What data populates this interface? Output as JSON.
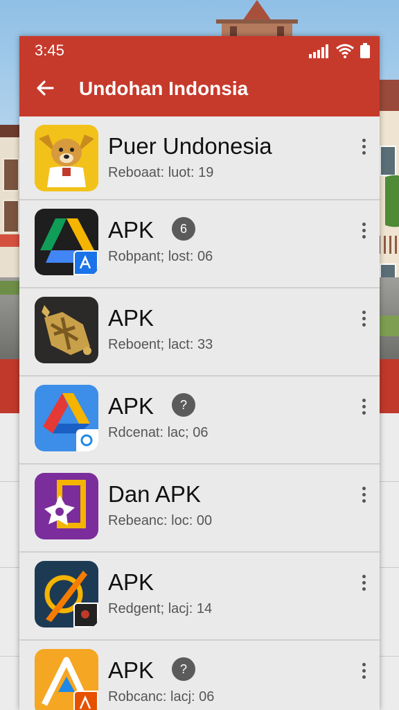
{
  "status_bar": {
    "time": "3:45"
  },
  "app_bar": {
    "title": "Undohan Indonsia"
  },
  "apps": [
    {
      "title": "Puer Undonesia",
      "subtitle": "Reboaat: luot: 19",
      "badge": ""
    },
    {
      "title": "APK",
      "subtitle": "Robpant; lost: 06",
      "badge": "6"
    },
    {
      "title": "APK",
      "subtitle": "Reboent; lact: 33",
      "badge": ""
    },
    {
      "title": "APK",
      "subtitle": "Rdcenat: lac; 06",
      "badge": "?"
    },
    {
      "title": "Dan APK",
      "subtitle": "Rebeanc: loc: 00",
      "badge": ""
    },
    {
      "title": "APK",
      "subtitle": "Redgent; lacj: 14",
      "badge": ""
    },
    {
      "title": "APK",
      "subtitle": "Robcanc: lacj: 06",
      "badge": "?"
    }
  ],
  "colors": {
    "app_bar": "#c63a2c",
    "list_bg": "#eaeaea",
    "badge": "#5b5b5b"
  }
}
